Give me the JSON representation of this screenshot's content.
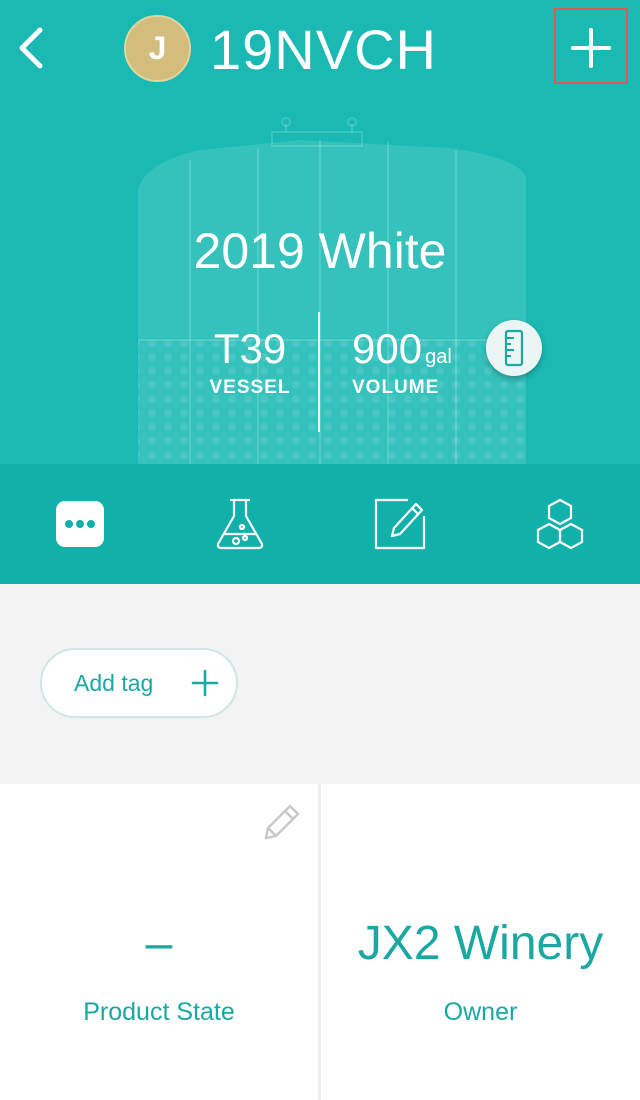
{
  "header": {
    "avatar_initial": "J",
    "lot_code": "19NVCH",
    "back_icon": "chevron-left-icon",
    "add_icon": "plus-icon"
  },
  "lot": {
    "name": "2019 White",
    "vessel_value": "T39",
    "vessel_label": "VESSEL",
    "volume_value": "900",
    "volume_unit": "gal",
    "volume_label": "VOLUME",
    "measure_icon": "ruler-icon"
  },
  "tabs": [
    {
      "icon": "more-icon",
      "active": true
    },
    {
      "icon": "lab-flask-icon",
      "active": false
    },
    {
      "icon": "notes-edit-icon",
      "active": false
    },
    {
      "icon": "hexagons-icon",
      "active": false
    }
  ],
  "tags": {
    "add_label": "Add tag"
  },
  "details": {
    "product_state_value": "–",
    "product_state_label": "Product State",
    "owner_value": "JX2 Winery",
    "owner_label": "Owner"
  },
  "colors": {
    "hero": "#1ab9b3",
    "tab_bar": "#12b0aa",
    "accent_text": "#1aa8a2",
    "avatar": "#d2bd7c",
    "highlight_border": "#e0575a"
  }
}
